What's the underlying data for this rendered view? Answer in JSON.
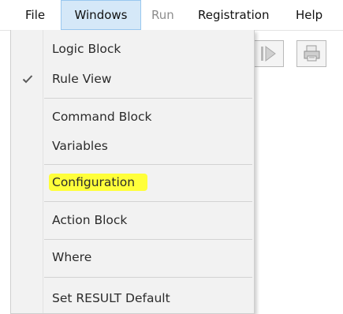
{
  "menubar": {
    "items": [
      {
        "label": "File",
        "state": "normal"
      },
      {
        "label": "Windows",
        "state": "open"
      },
      {
        "label": "Run",
        "state": "disabled"
      },
      {
        "label": "Registration",
        "state": "normal"
      },
      {
        "label": "Help",
        "state": "normal"
      }
    ]
  },
  "toolbar": {
    "buttons": [
      {
        "icon": "play-icon",
        "state": "disabled"
      },
      {
        "icon": "printer-icon",
        "state": "disabled"
      }
    ]
  },
  "windows_menu": {
    "items": [
      {
        "label": "Logic Block",
        "checked": false
      },
      {
        "label": "Rule View",
        "checked": true
      },
      {
        "label": "Command Block",
        "checked": false
      },
      {
        "label": "Variables",
        "checked": false
      },
      {
        "label": "Configuration",
        "checked": false,
        "highlighted": true
      },
      {
        "label": "Action Block",
        "checked": false
      },
      {
        "label": "Where",
        "checked": false
      },
      {
        "label": "Set RESULT Default",
        "checked": false
      }
    ],
    "highlight_color": "#ffff3a"
  },
  "colors": {
    "menu_open_bg": "#d5e8f8",
    "menu_open_border": "#99c8ef",
    "disabled_text": "#8d8d8d",
    "dropdown_bg": "#f2f2f2"
  }
}
